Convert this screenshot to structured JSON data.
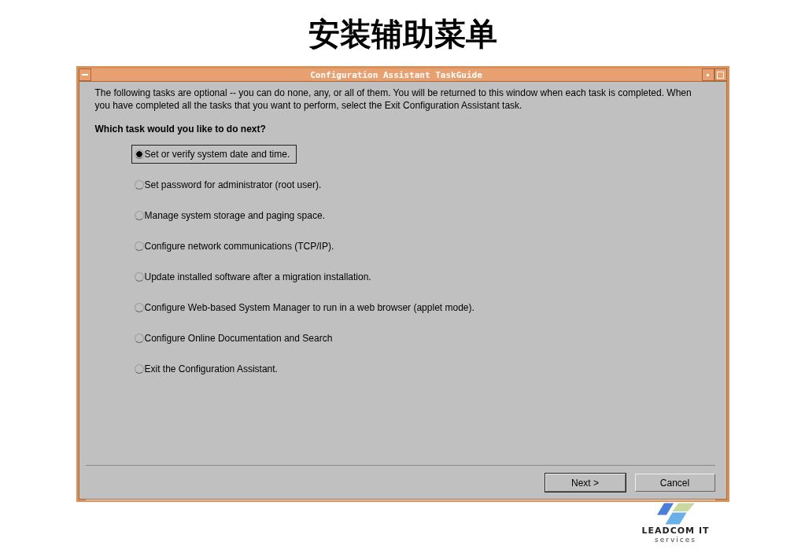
{
  "slide_title": "安装辅助菜单",
  "window": {
    "title": "Configuration Assistant TaskGuide"
  },
  "intro": "The following tasks are optional -- you can do none, any, or all of them.  You will be returned to this window when each task is completed.  When you have completed all the tasks that you want to perform, select the Exit Configuration Assistant task.",
  "question": "Which task would you like to do next?",
  "tasks": [
    {
      "label": "Set or verify system date and time.",
      "selected": true
    },
    {
      "label": "Set password for administrator (root user).",
      "selected": false
    },
    {
      "label": "Manage system storage and paging space.",
      "selected": false
    },
    {
      "label": "Configure network communications (TCP/IP).",
      "selected": false
    },
    {
      "label": "Update installed software after a migration installation.",
      "selected": false
    },
    {
      "label": "Configure Web-based System Manager to run in a web browser (applet mode).",
      "selected": false
    },
    {
      "label": "Configure Online Documentation and Search",
      "selected": false
    },
    {
      "label": "Exit the Configuration Assistant.",
      "selected": false
    }
  ],
  "buttons": [
    {
      "label": "Next >",
      "default": true
    },
    {
      "label": "Cancel",
      "default": false
    }
  ],
  "logo": {
    "name": "LEADCOM IT",
    "tagline": "services"
  }
}
